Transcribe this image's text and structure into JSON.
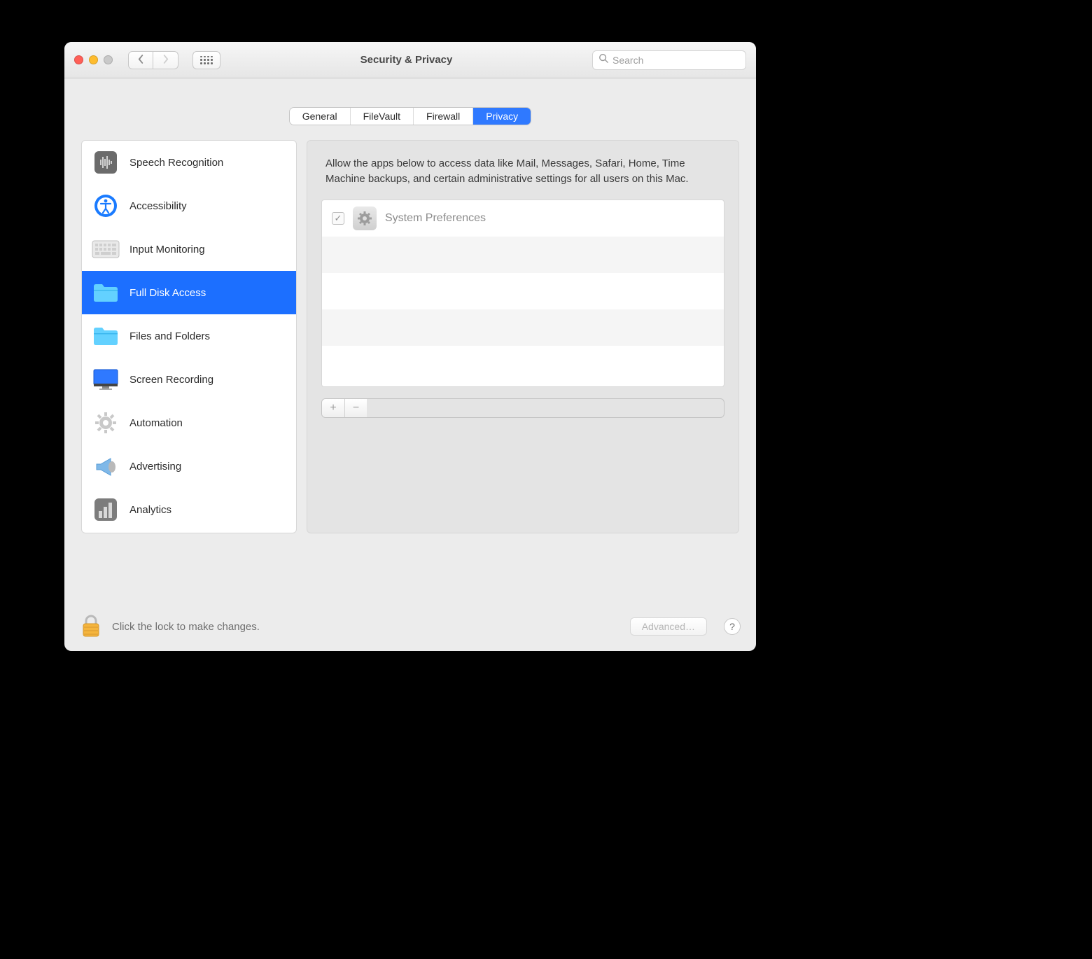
{
  "window": {
    "title": "Security & Privacy",
    "search_placeholder": "Search"
  },
  "tabs": [
    {
      "label": "General",
      "active": false
    },
    {
      "label": "FileVault",
      "active": false
    },
    {
      "label": "Firewall",
      "active": false
    },
    {
      "label": "Privacy",
      "active": true
    }
  ],
  "sidebar": {
    "items": [
      {
        "label": "Speech Recognition",
        "icon": "waveform-icon",
        "selected": false
      },
      {
        "label": "Accessibility",
        "icon": "accessibility-icon",
        "selected": false
      },
      {
        "label": "Input Monitoring",
        "icon": "keyboard-icon",
        "selected": false
      },
      {
        "label": "Full Disk Access",
        "icon": "folder-icon",
        "selected": true
      },
      {
        "label": "Files and Folders",
        "icon": "folder-icon",
        "selected": false
      },
      {
        "label": "Screen Recording",
        "icon": "display-icon",
        "selected": false
      },
      {
        "label": "Automation",
        "icon": "gear-icon",
        "selected": false
      },
      {
        "label": "Advertising",
        "icon": "megaphone-icon",
        "selected": false
      },
      {
        "label": "Analytics",
        "icon": "barchart-icon",
        "selected": false
      }
    ]
  },
  "main": {
    "description": "Allow the apps below to access data like Mail, Messages, Safari, Home, Time Machine backups, and certain administrative settings for all users on this Mac.",
    "apps": [
      {
        "name": "System Preferences",
        "checked": true,
        "disabled": true
      }
    ]
  },
  "footer": {
    "lock_text": "Click the lock to make changes.",
    "advanced_label": "Advanced…"
  }
}
